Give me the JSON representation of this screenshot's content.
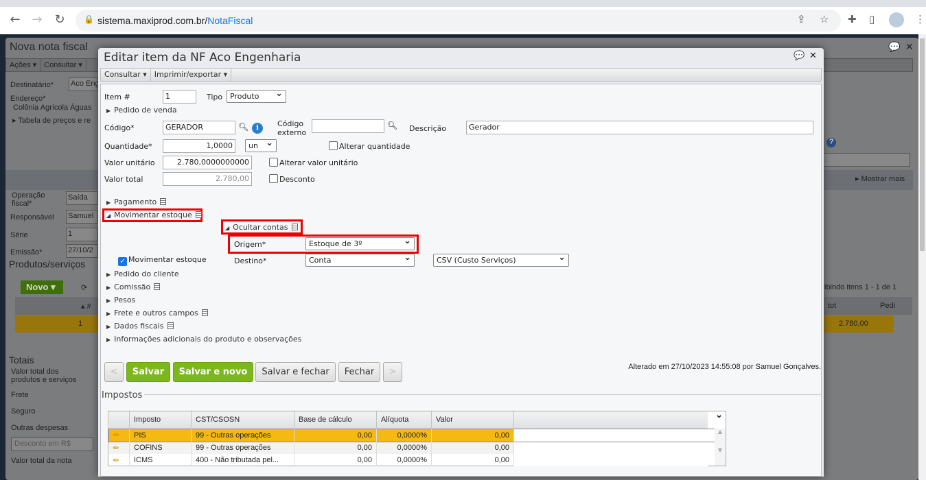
{
  "browser": {
    "url_host": "sistema.maxiprod.com.br/",
    "url_path": "NotaFiscal"
  },
  "bg": {
    "title": "Nova nota fiscal",
    "menu": [
      "Ações",
      "Consultar"
    ],
    "destinatario_label": "Destinatário*",
    "destinatario_value": "Aco Eng",
    "endereco_label": "Endereço*",
    "endereco_value": "Colônia Agrícola Águas",
    "tabela": "Tabela de preços e re",
    "operacao_label": "Operação fiscal*",
    "operacao_value": "Saída",
    "responsavel_label": "Responsável",
    "responsavel_value": "Samuel",
    "serie_label": "Série",
    "serie_value": "1",
    "emissao_label": "Emissão*",
    "emissao_value": "27/10/2",
    "produtos_title": "Produtos/serviços",
    "novo": "Novo",
    "grid_col": "#",
    "grid_row_num": "1",
    "paging": "ibindo itens 1 - 1 de 1",
    "col_tot": "tot",
    "col_pedi": "Pedi",
    "row_tot": "2.780,00",
    "mostrar_mais": "Mostrar mais",
    "totais": "Totais",
    "valor_total_prod": "Valor total dos produtos e serviços",
    "frete": "Frete",
    "seguro": "Seguro",
    "outras": "Outras despesas",
    "desconto_sel": "Desconto em R$",
    "valor_total_nota": "Valor total da nota"
  },
  "modal": {
    "title": "Editar item da NF Aco Engenharia",
    "toolbar": [
      "Consultar",
      "Imprimir/exportar"
    ],
    "item_label": "Item #",
    "item_value": "1",
    "tipo_label": "Tipo",
    "tipo_value": "Produto",
    "pedido_venda": "Pedido de venda",
    "codigo_label": "Código*",
    "codigo_value": "GERADOR",
    "codigo_externo_label": "Código externo",
    "codigo_externo_value": "",
    "descricao_label": "Descrição",
    "descricao_value": "Gerador",
    "quantidade_label": "Quantidade*",
    "quantidade_value": "1,0000",
    "unidade": "un",
    "alterar_quantidade": "Alterar quantidade",
    "valor_unitario_label": "Valor unitário",
    "valor_unitario_value": "2.780,0000000000",
    "alterar_valor_unitario": "Alterar valor unitário",
    "valor_total_label": "Valor total",
    "valor_total_value": "2.780,00",
    "desconto": "Desconto",
    "pagamento": "Pagamento",
    "movimentar_estoque_section": "Movimentar estoque",
    "ocultar_contas": "Ocultar contas",
    "origem_label": "Origem*",
    "origem_value": "Estoque de 3º",
    "movimentar_estoque_checkbox": "Movimentar estoque",
    "destino_label": "Destino*",
    "destino_value": "Conta",
    "destino_conta": "CSV (Custo Serviços)",
    "sections": [
      "Pedido do cliente",
      "Comissão",
      "Pesos",
      "Frete e outros campos",
      "Dados fiscais",
      "Informações adicionais do produto e observações"
    ],
    "buttons": {
      "prev": "<",
      "salvar": "Salvar",
      "salvar_novo": "Salvar e novo",
      "salvar_fechar": "Salvar e fechar",
      "fechar": "Fechar",
      "next": ">"
    },
    "alterado": "Alterado em 27/10/2023 14:55:08 por Samuel Gonçalves.",
    "impostos_title": "Impostos",
    "impostos_headers": [
      "Imposto",
      "CST/CSOSN",
      "Base de cálculo",
      "Alíquota",
      "Valor"
    ],
    "impostos_rows": [
      {
        "imposto": "PIS",
        "cst": "99 - Outras operações",
        "base": "0,00",
        "aliquota": "0,0000%",
        "valor": "0,00"
      },
      {
        "imposto": "COFINS",
        "cst": "99 - Outras operações",
        "base": "0,00",
        "aliquota": "0,0000%",
        "valor": "0,00"
      },
      {
        "imposto": "ICMS",
        "cst": "400 - Não tributada pel...",
        "base": "0,00",
        "aliquota": "0,0000%",
        "valor": "0,00"
      }
    ]
  },
  "colors": {
    "highlight": "#f4b913",
    "save_green": "#7cb71c",
    "annotation_red": "#e00000"
  }
}
